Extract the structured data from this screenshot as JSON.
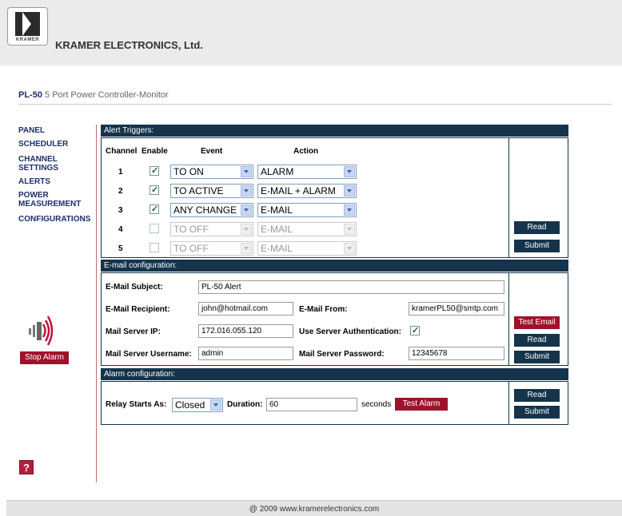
{
  "header": {
    "logo_text": "KRAMER",
    "company": "KRAMER ELECTRONICS, Ltd."
  },
  "product": {
    "model": "PL-50",
    "description": "5 Port Power Controller-Monitor"
  },
  "nav": [
    "PANEL",
    "SCHEDULER",
    "CHANNEL",
    "SETTINGS",
    "ALERTS",
    "POWER",
    "MEASUREMENT",
    "CONFIGURATIONS"
  ],
  "stop_alarm": "Stop Alarm",
  "help": "?",
  "alert_triggers": {
    "title": "Alert Triggers:",
    "headers": {
      "channel": "Channel",
      "enable": "Enable",
      "event": "Event",
      "action": "Action"
    },
    "rows": [
      {
        "channel": "1",
        "enabled": true,
        "event": "TO ON",
        "action": "ALARM"
      },
      {
        "channel": "2",
        "enabled": true,
        "event": "TO ACTIVE",
        "action": "E-MAIL + ALARM"
      },
      {
        "channel": "3",
        "enabled": true,
        "event": "ANY CHANGE",
        "action": "E-MAIL"
      },
      {
        "channel": "4",
        "enabled": false,
        "event": "TO OFF",
        "action": "E-MAIL"
      },
      {
        "channel": "5",
        "enabled": false,
        "event": "TO OFF",
        "action": "E-MAIL"
      }
    ],
    "read": "Read",
    "submit": "Submit"
  },
  "email": {
    "title": "E-mail configuration:",
    "subject_label": "E-Mail Subject:",
    "subject": "PL-50 Alert",
    "recipient_label": "E-Mail Recipient:",
    "recipient": "john@hotmail.com",
    "from_label": "E-Mail From:",
    "from": "kramerPL50@smtp.com",
    "server_ip_label": "Mail Server IP:",
    "server_ip": "172.016.055.120",
    "auth_label": "Use Server Authentication:",
    "auth": true,
    "username_label": "Mail Server Username:",
    "username": "admin",
    "password_label": "Mail Server Password:",
    "password": "12345678",
    "test": "Test Email",
    "read": "Read",
    "submit": "Submit"
  },
  "alarm": {
    "title": "Alarm configuration:",
    "relay_label": "Relay Starts As:",
    "relay": "Closed",
    "duration_label": "Duration:",
    "duration": "60",
    "unit": "seconds",
    "test": "Test Alarm",
    "read": "Read",
    "submit": "Submit"
  },
  "footer": "@ 2009 www.kramerelectronics.com",
  "colors": {
    "bar": "#15344b",
    "red_button": "#a0122b",
    "nav": "#1c2f67"
  }
}
